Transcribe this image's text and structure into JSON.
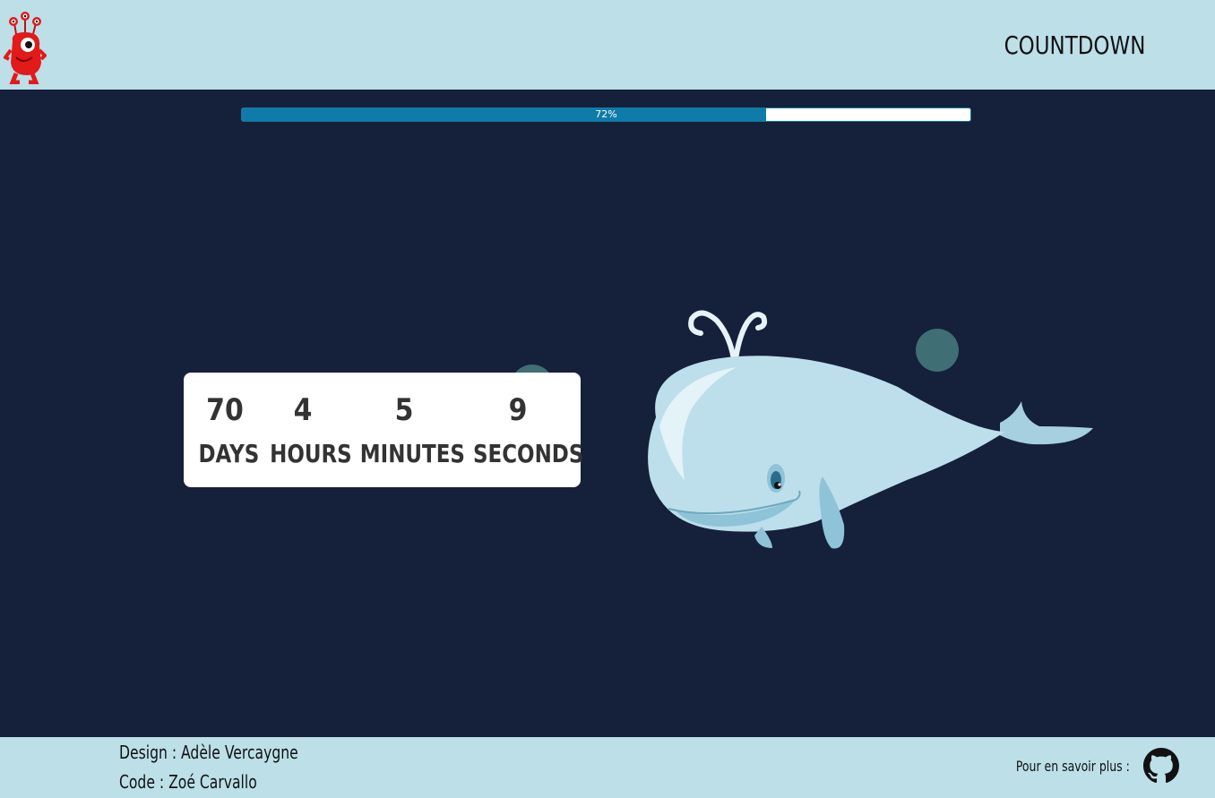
{
  "header": {
    "logo_icon": "red-monster-logo-icon",
    "title": "COUNTDOWN"
  },
  "progress": {
    "value_percent": 72,
    "label": "72%"
  },
  "countdown": {
    "days": {
      "value": "70",
      "label": "DAYS"
    },
    "hours": {
      "value": "4",
      "label": "HOURS"
    },
    "minutes": {
      "value": "5",
      "label": "MINUTES"
    },
    "seconds": {
      "value": "9",
      "label": "SECONDS"
    }
  },
  "illustration": {
    "icon": "whale-icon",
    "bubble_icon": "bubble-icon"
  },
  "footer": {
    "design_credit": "Design : Adèle Vercaygne",
    "code_credit": "Code : Zoé Carvallo",
    "more_label": "Pour en savoir plus :",
    "github_icon": "github-icon"
  },
  "colors": {
    "background": "#15203b",
    "header_bg": "#bcdfe8",
    "progress_fill": "#0e7ba8",
    "bubble": "#3f6e74"
  }
}
